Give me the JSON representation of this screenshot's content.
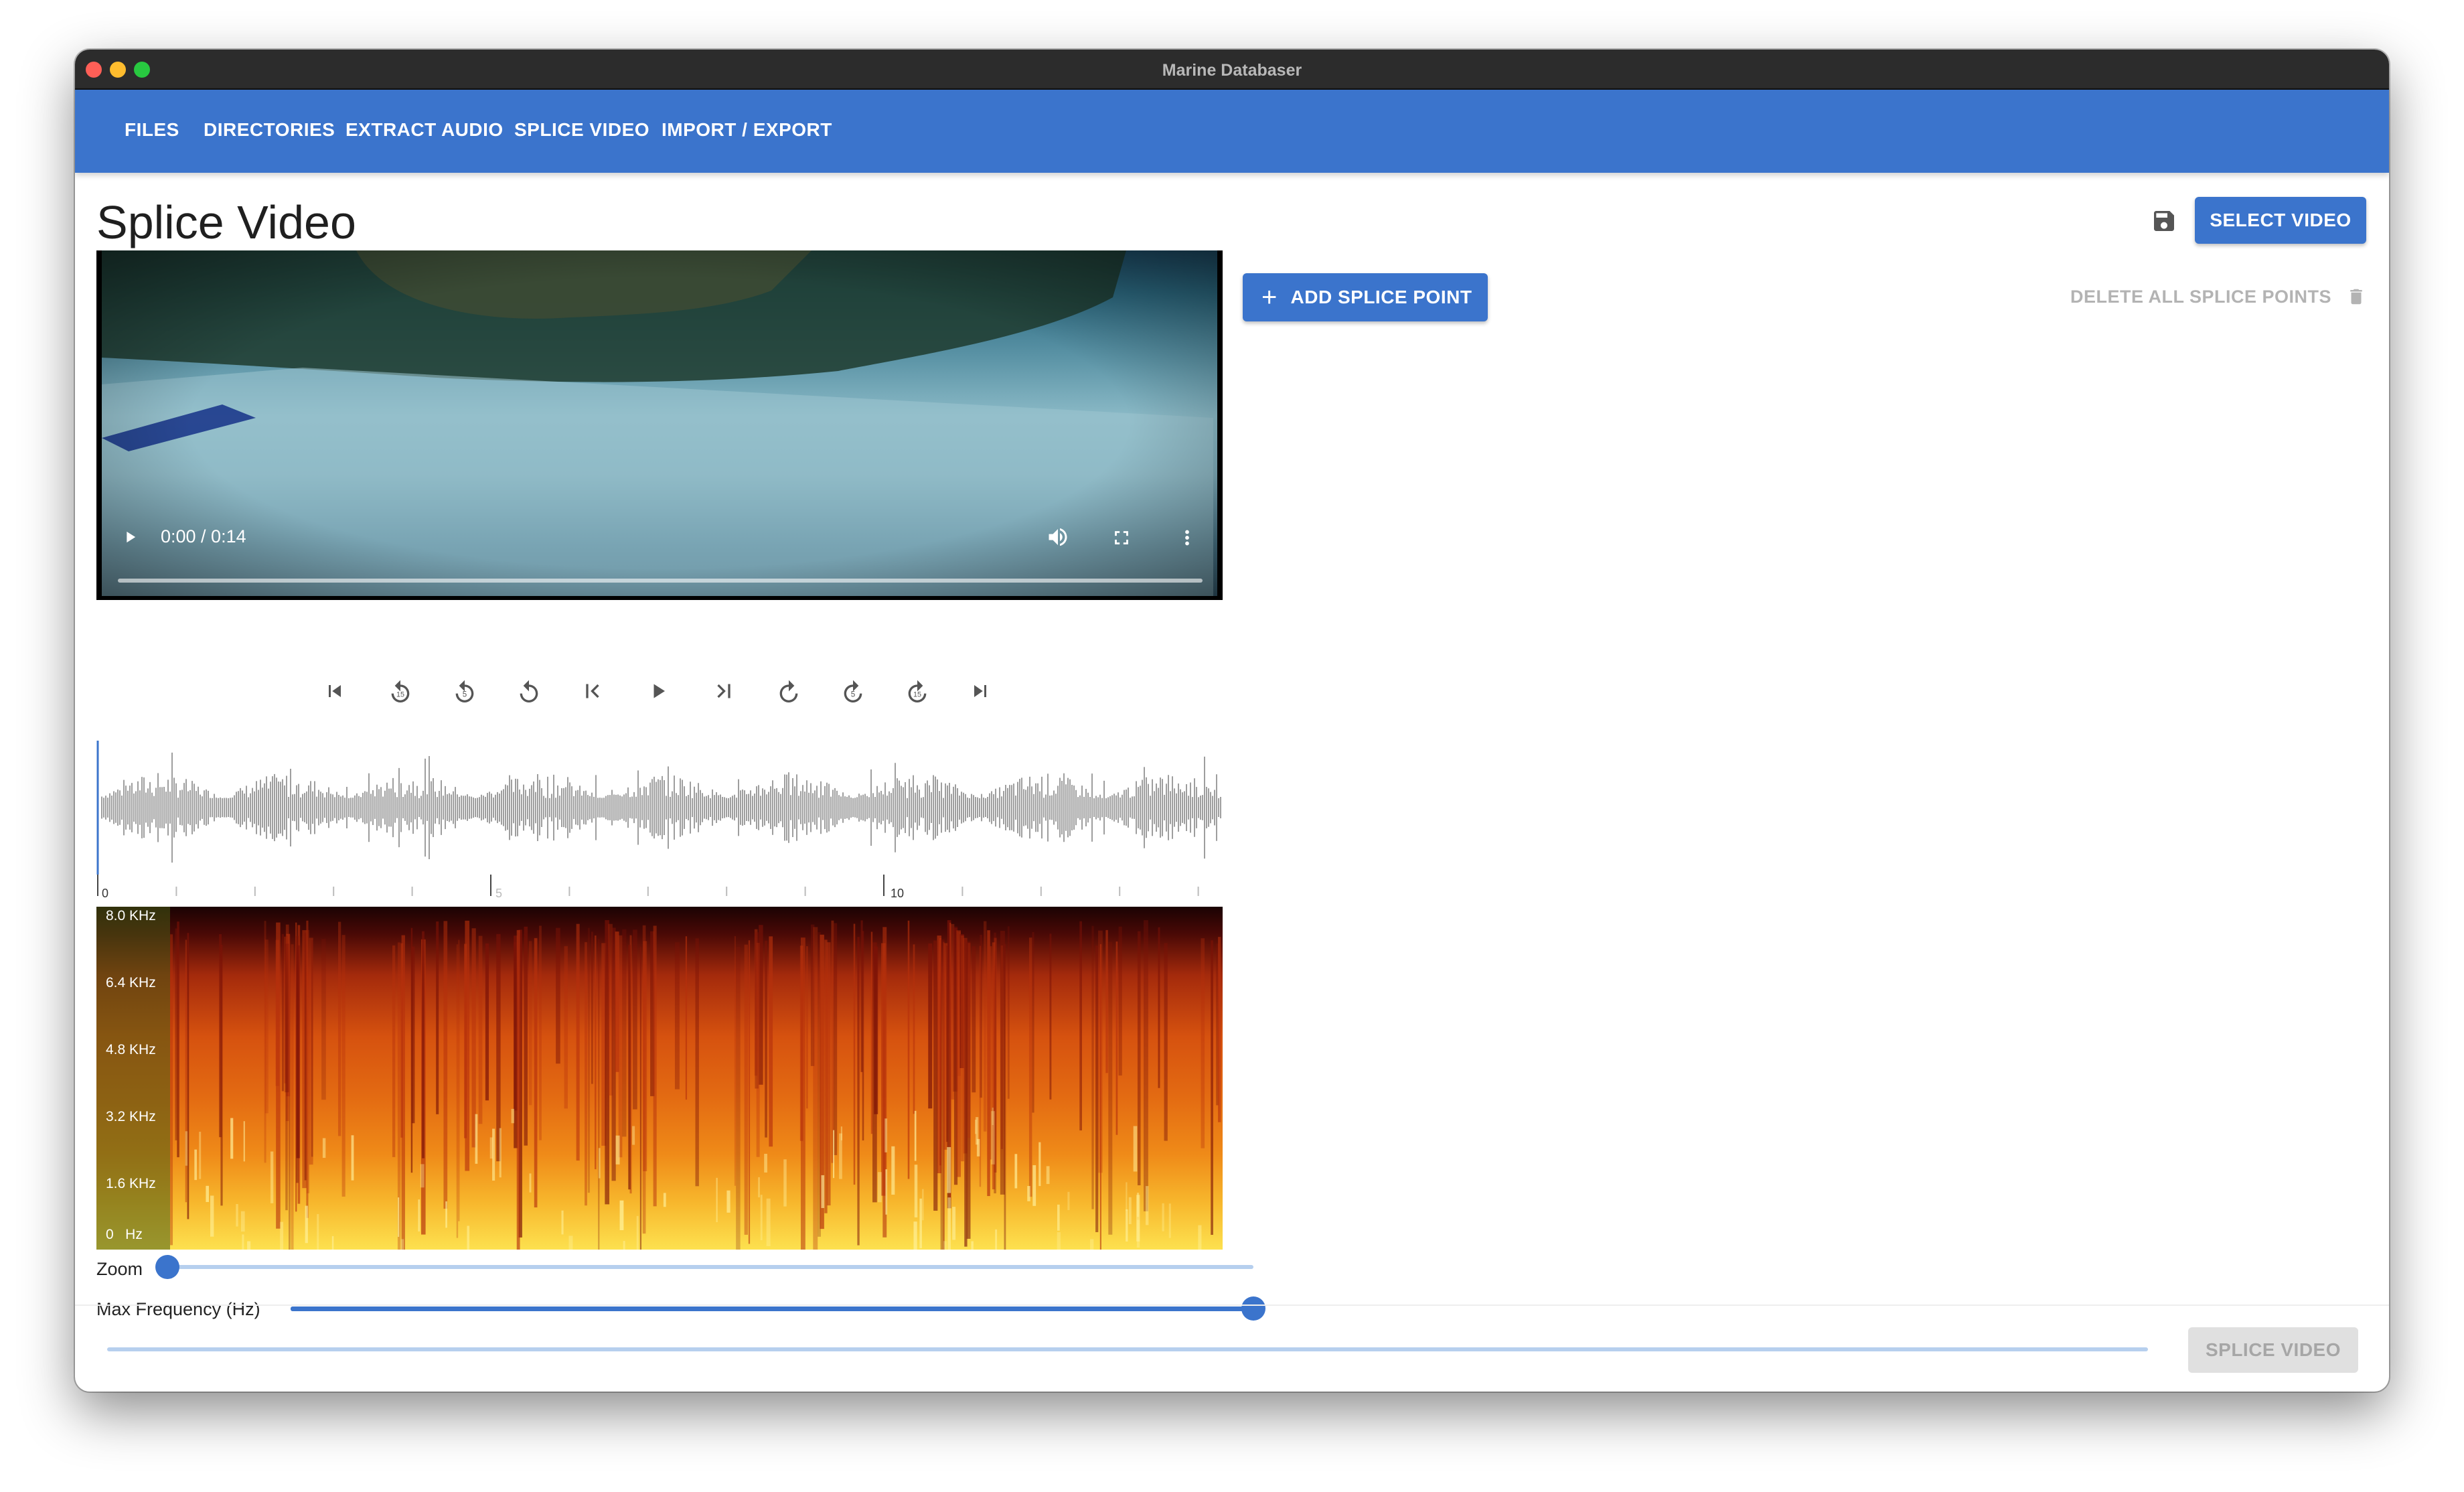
{
  "window": {
    "title": "Marine Databaser"
  },
  "nav": {
    "items": [
      {
        "label": "FILES"
      },
      {
        "label": "DIRECTORIES"
      },
      {
        "label": "EXTRACT AUDIO"
      },
      {
        "label": "SPLICE VIDEO"
      },
      {
        "label": "IMPORT / EXPORT"
      }
    ]
  },
  "page": {
    "title": "Splice Video"
  },
  "toolbar": {
    "save_icon": "save-icon",
    "download_icon": "download-icon",
    "select_video_label": "SELECT VIDEO"
  },
  "splice": {
    "add_label": "ADD SPLICE POINT",
    "delete_all_label": "DELETE ALL SPLICE POINTS",
    "splice_button_label": "SPLICE VIDEO"
  },
  "video": {
    "time": "0:00 / 0:14",
    "progress": 0.0
  },
  "transport": {
    "buttons": [
      "skip-to-start-icon",
      "rewind-15-icon",
      "rewind-5-icon",
      "rewind-1-icon",
      "previous-frame-icon",
      "play-icon",
      "next-frame-icon",
      "forward-1-icon",
      "forward-5-icon",
      "forward-15-icon",
      "skip-to-end-icon"
    ]
  },
  "timeline": {
    "labels": [
      "0",
      "5",
      "10"
    ]
  },
  "spectrogram": {
    "freq_labels": [
      "8.0 KHz",
      "6.4 KHz",
      "4.8 KHz",
      "3.2 KHz",
      "1.6 KHz",
      "0   Hz"
    ]
  },
  "controls": {
    "zoom_label": "Zoom",
    "zoom_value": 0.0,
    "max_freq_label": "Max Frequency (Hz)",
    "max_freq_value": 1.0
  },
  "colors": {
    "accent": "#3b74cc",
    "titlebar": "#2c2c2c"
  }
}
